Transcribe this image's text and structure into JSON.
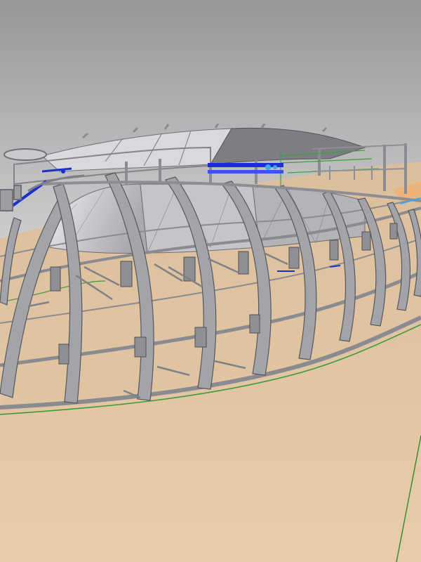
{
  "viewport": {
    "view": "3d-perspective",
    "background_colors": {
      "sky_top": "#9a9a9a",
      "sky_bottom": "#c9c9c9",
      "ground": "#e2c7a6",
      "ground_far": "#d7b997"
    },
    "model": {
      "subject": "stadium-roof-steel-frame",
      "frame_color": "#9fa1a6",
      "frame_dark": "#6c6e73",
      "canopy_light": "#e8e8ea",
      "canopy_dark": "#6d6e72",
      "highlight_blue": "#1b2fd0",
      "highlight_cyan": "#38a8f0",
      "edge_green": "#3a9a3a",
      "edge_orange": "#f0a050"
    }
  }
}
